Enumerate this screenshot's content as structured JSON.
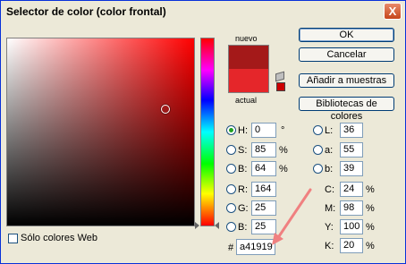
{
  "window": {
    "title": "Selector de color (color frontal)",
    "close_glyph": "X"
  },
  "preview": {
    "new_label": "nuevo",
    "current_label": "actual",
    "new_color": "#a41919",
    "current_color": "#e5262a",
    "web_safe_color": "#cc0000"
  },
  "buttons": {
    "ok": "OK",
    "cancel": "Cancelar",
    "add_swatches": "Añadir a muestras",
    "libraries": "Bibliotecas de colores"
  },
  "hsb": {
    "h": {
      "label": "H:",
      "value": "0",
      "unit": "°"
    },
    "s": {
      "label": "S:",
      "value": "85",
      "unit": "%"
    },
    "b": {
      "label": "B:",
      "value": "64",
      "unit": "%"
    }
  },
  "rgb": {
    "r": {
      "label": "R:",
      "value": "164"
    },
    "g": {
      "label": "G:",
      "value": "25"
    },
    "b": {
      "label": "B:",
      "value": "25"
    }
  },
  "lab": {
    "l": {
      "label": "L:",
      "value": "36"
    },
    "a": {
      "label": "a:",
      "value": "55"
    },
    "b": {
      "label": "b:",
      "value": "39"
    }
  },
  "cmyk": {
    "c": {
      "label": "C:",
      "value": "24",
      "unit": "%"
    },
    "m": {
      "label": "M:",
      "value": "98",
      "unit": "%"
    },
    "y": {
      "label": "Y:",
      "value": "100",
      "unit": "%"
    },
    "k": {
      "label": "K:",
      "value": "20",
      "unit": "%"
    }
  },
  "hex": {
    "prefix": "#",
    "value": "a41919"
  },
  "web_only": {
    "label": "Sólo colores Web",
    "checked": false
  },
  "colors": {
    "annotation_arrow": "#f08080",
    "ok_border": "#003c74"
  }
}
